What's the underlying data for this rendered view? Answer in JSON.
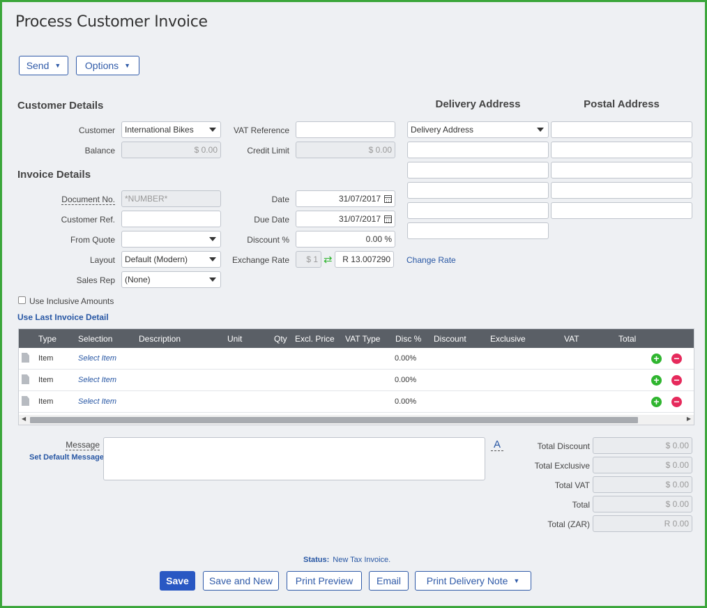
{
  "page": {
    "title": "Process Customer Invoice"
  },
  "toolbar": {
    "send_label": "Send",
    "options_label": "Options"
  },
  "customer_details": {
    "heading": "Customer Details",
    "customer_label": "Customer",
    "customer_value": "International Bikes",
    "balance_label": "Balance",
    "balance_value": "$ 0.00",
    "vat_ref_label": "VAT Reference",
    "vat_ref_value": "",
    "credit_limit_label": "Credit Limit",
    "credit_limit_value": "$ 0.00"
  },
  "invoice_details": {
    "heading": "Invoice Details",
    "doc_no_label": "Document No.",
    "doc_no_placeholder": "*NUMBER*",
    "customer_ref_label": "Customer Ref.",
    "customer_ref_value": "",
    "from_quote_label": "From Quote",
    "from_quote_value": "",
    "layout_label": "Layout",
    "layout_value": "Default (Modern)",
    "sales_rep_label": "Sales Rep",
    "sales_rep_value": "(None)",
    "date_label": "Date",
    "date_value": "31/07/2017",
    "due_date_label": "Due Date",
    "due_date_value": "31/07/2017",
    "discount_label": "Discount %",
    "discount_value": "0.00 %",
    "exchange_rate_label": "Exchange Rate",
    "exchange_base": "$ 1",
    "exchange_value": "R 13.007290",
    "change_rate_label": "Change Rate"
  },
  "addresses": {
    "delivery_heading": "Delivery Address",
    "postal_heading": "Postal Address",
    "delivery_select_value": "Delivery Address"
  },
  "options": {
    "use_inclusive_label": "Use Inclusive Amounts",
    "use_last_invoice_label": "Use Last Invoice Detail"
  },
  "grid": {
    "columns": [
      "Type",
      "Selection",
      "Description",
      "Unit",
      "Qty",
      "Excl. Price",
      "VAT Type",
      "Disc %",
      "Discount",
      "Exclusive",
      "VAT",
      "Total"
    ],
    "rows": [
      {
        "type": "Item",
        "selection": "Select Item",
        "disc": "0.00%"
      },
      {
        "type": "Item",
        "selection": "Select Item",
        "disc": "0.00%"
      },
      {
        "type": "Item",
        "selection": "Select Item",
        "disc": "0.00%"
      }
    ]
  },
  "message": {
    "label": "Message",
    "set_default_label": "Set Default Message",
    "font_glyph": "A"
  },
  "totals": {
    "total_discount_label": "Total Discount",
    "total_discount_value": "$ 0.00",
    "total_exclusive_label": "Total Exclusive",
    "total_exclusive_value": "$ 0.00",
    "total_vat_label": "Total VAT",
    "total_vat_value": "$ 0.00",
    "total_label": "Total",
    "total_value": "$ 0.00",
    "total_zar_label": "Total (ZAR)",
    "total_zar_value": "R 0.00"
  },
  "status": {
    "label": "Status:",
    "value": "New Tax Invoice."
  },
  "footer": {
    "save_label": "Save",
    "save_new_label": "Save and New",
    "print_preview_label": "Print Preview",
    "email_label": "Email",
    "print_delivery_label": "Print Delivery Note"
  },
  "colors": {
    "frame_border": "#3aa63a",
    "accent": "#2958c3",
    "link": "#2857a4",
    "grid_header": "#5a5f66"
  },
  "icons": [
    "caret-down-icon",
    "calendar-icon",
    "exchange-icon",
    "document-icon",
    "add-row-icon",
    "remove-row-icon",
    "font-icon"
  ]
}
